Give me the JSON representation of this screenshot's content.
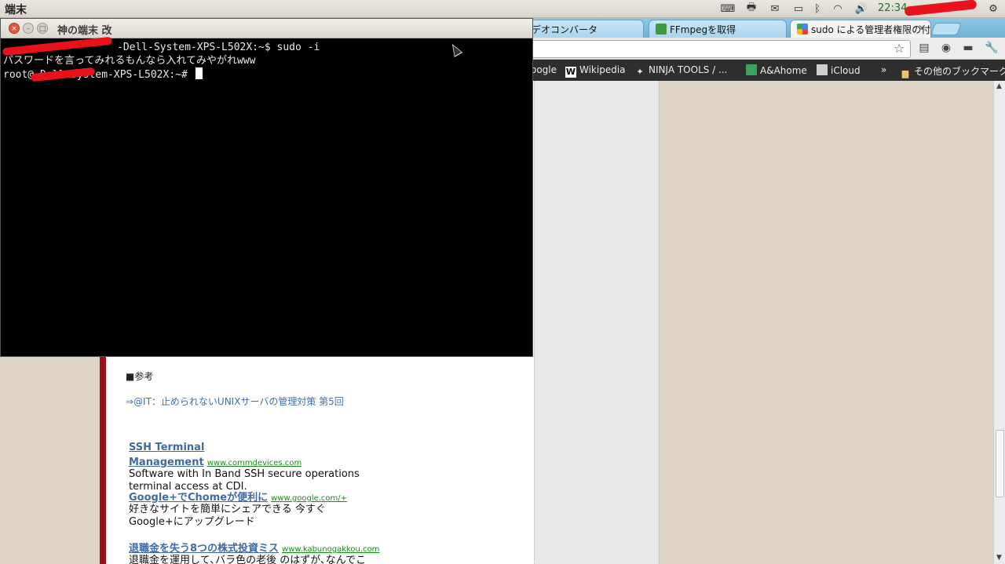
{
  "panel": {
    "app_name": "端末",
    "clock": "22:34",
    "tray_icons": [
      "keyboard-icon",
      "printer-icon",
      "mail-icon",
      "battery-icon",
      "bluetooth-icon",
      "wifi-icon",
      "volume-icon",
      "gear-icon"
    ]
  },
  "browser": {
    "tabs": [
      {
        "label": "デオコンバータ",
        "favicon": "video-converter-icon"
      },
      {
        "label": "FFmpegを取得",
        "favicon": "ffmpeg-icon"
      },
      {
        "label": "sudo による管理者権限の付",
        "favicon": "google-icon",
        "active": true
      }
    ],
    "bookmarks": [
      {
        "label": "oogle",
        "icon": "google-icon"
      },
      {
        "label": "Wikipedia",
        "icon": "wikipedia-icon"
      },
      {
        "label": "NINJA TOOLS / ...",
        "icon": "ninja-icon"
      },
      {
        "label": "A&Ahome",
        "icon": "aahome-icon"
      },
      {
        "label": "iCloud",
        "icon": "icloud-icon"
      },
      {
        "label": "その他のブックマーク",
        "icon": "folder-icon"
      }
    ],
    "overflow": "»"
  },
  "page": {
    "ref_heading": "■参考",
    "ref_link": "⇒@IT：止められないUNIXサーバの管理対策 第5回",
    "ads": [
      {
        "title": "SSH Terminal Management",
        "url": "www.commdevices.com",
        "desc": "Software with In Band SSH secure operations terminal access at CDI."
      },
      {
        "title": "Google+でChomeが便利に",
        "url": "www.google.com/+",
        "desc": "好きなサイトを簡単にシェアできる 今すぐGoogle+にアップグレード"
      },
      {
        "title": "退職金を失う8つの株式投資ミス",
        "url": "www.kabunogakkou.com",
        "desc": "退職金を運用して､バラ色の老後 のはずが､なんでこんなことに･･"
      }
    ]
  },
  "terminal": {
    "title": "神の端末 改",
    "lines": [
      "-Dell-System-XPS-L502X:~$ sudo -i",
      "パスワードを言ってみれるもんなら入れてみやがれwww",
      "root@-Dell-System-XPS-L502X:~# "
    ]
  }
}
